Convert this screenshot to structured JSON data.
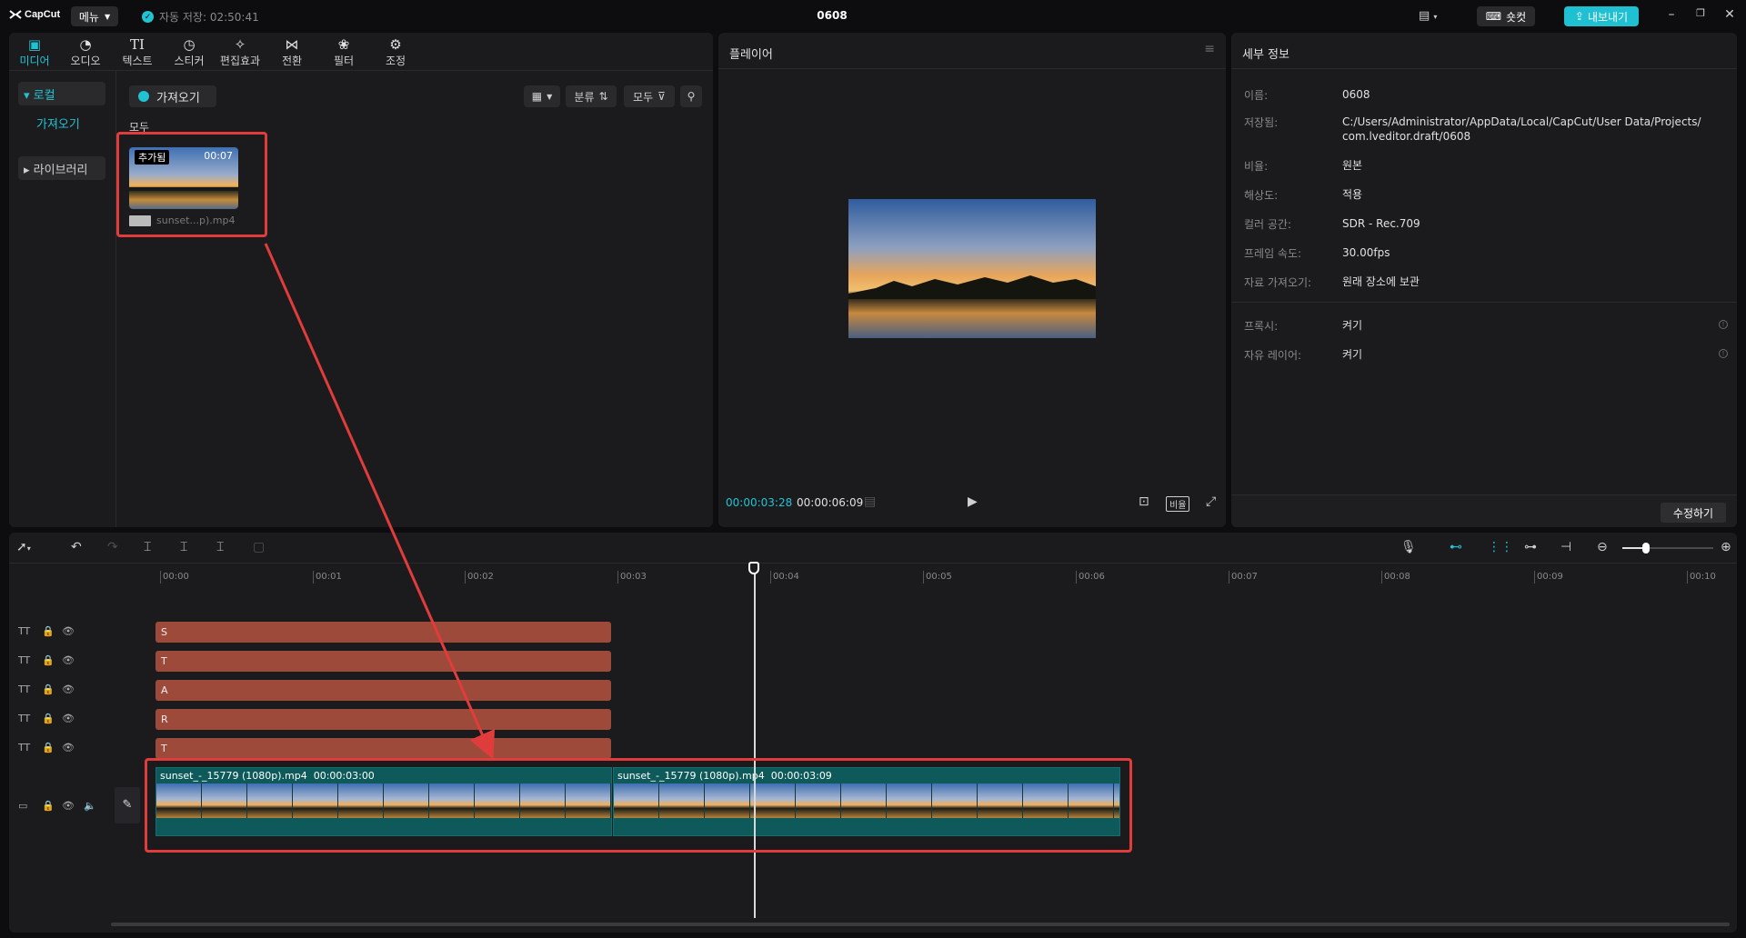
{
  "app": {
    "logo_text": "CapCut",
    "menu_label": "메뉴",
    "autosave_text": "자동 저장: 02:50:41",
    "project_title": "0608",
    "shortcut_label": "숏컷",
    "export_label": "내보내기"
  },
  "toolbar": {
    "tabs": [
      {
        "label": "미디어",
        "icon": "media-icon",
        "active": true
      },
      {
        "label": "오디오",
        "icon": "audio-icon"
      },
      {
        "label": "텍스트",
        "icon": "text-icon"
      },
      {
        "label": "스티커",
        "icon": "sticker-icon"
      },
      {
        "label": "편집효과",
        "icon": "effects-icon"
      },
      {
        "label": "전환",
        "icon": "transition-icon"
      },
      {
        "label": "필터",
        "icon": "filter-icon"
      },
      {
        "label": "조정",
        "icon": "adjust-icon"
      }
    ]
  },
  "sidebar": {
    "items": [
      {
        "label": "▾ 로컬",
        "active": true
      },
      {
        "label": "가져오기"
      },
      {
        "label": "▸ 라이브러리"
      }
    ]
  },
  "media": {
    "import_label": "가져오기",
    "sort_label": "분류",
    "filter_label": "모두",
    "section_all": "모두",
    "clip": {
      "badge": "추가됨",
      "duration": "00:07",
      "name": "sunset...p).mp4"
    }
  },
  "player": {
    "title": "플레이어",
    "current_time": "00:00:03:28",
    "total_time": "00:00:06:09",
    "ratio_label": "비율"
  },
  "details": {
    "title": "세부 정보",
    "rows": [
      {
        "key": "이름:",
        "value": "0608"
      },
      {
        "key": "저장됨:",
        "value": "C:/Users/Administrator/AppData/Local/CapCut/User Data/Projects/com.lveditor.draft/0608"
      },
      {
        "key": "비율:",
        "value": "원본"
      },
      {
        "key": "해상도:",
        "value": "적용"
      },
      {
        "key": "컬러 공간:",
        "value": "SDR - Rec.709"
      },
      {
        "key": "프레임 속도:",
        "value": "30.00fps"
      },
      {
        "key": "자료 가져오기:",
        "value": "원래 장소에 보관"
      },
      {
        "key": "프록시:",
        "value": "켜기"
      },
      {
        "key": "자유 레이어:",
        "value": "켜기"
      }
    ],
    "edit_label": "수정하기"
  },
  "timeline": {
    "ruler": [
      "00:00",
      "00:01",
      "00:02",
      "00:03",
      "00:04",
      "00:05",
      "00:06",
      "00:07",
      "00:08",
      "00:09",
      "00:10"
    ],
    "text_tracks": [
      "S",
      "T",
      "A",
      "R",
      "T"
    ],
    "video_clips": [
      {
        "name": "sunset_-_15779 (1080p).mp4",
        "duration": "00:00:03:00"
      },
      {
        "name": "sunset_-_15779 (1080p).mp4",
        "duration": "00:00:03:09"
      }
    ]
  },
  "colors": {
    "accent": "#21c3d3",
    "text_clip": "#9e4a3a",
    "video_clip": "#0e5a5a",
    "highlight": "#e03c3c"
  }
}
